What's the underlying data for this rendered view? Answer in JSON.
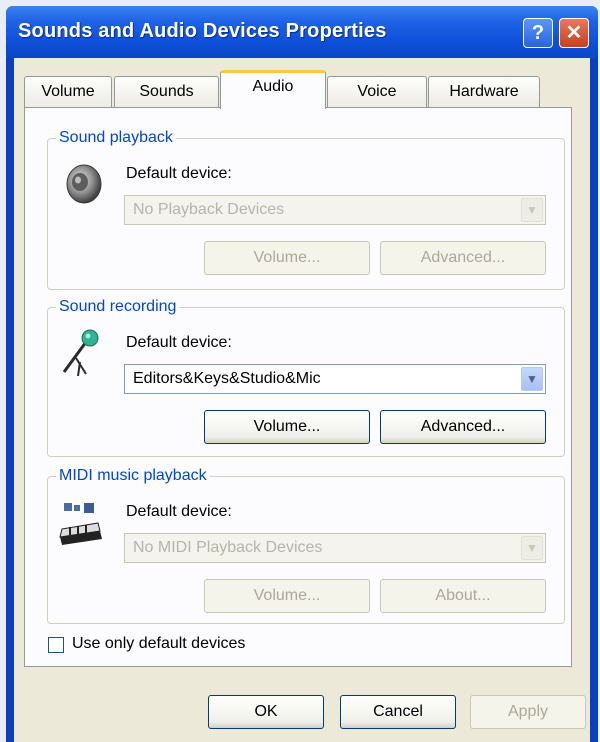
{
  "window": {
    "title": "Sounds and Audio Devices Properties",
    "help_label": "?",
    "close_label": "✕"
  },
  "tabs": [
    {
      "label": "Volume",
      "active": false
    },
    {
      "label": "Sounds",
      "active": false
    },
    {
      "label": "Audio",
      "active": true
    },
    {
      "label": "Voice",
      "active": false
    },
    {
      "label": "Hardware",
      "active": false
    }
  ],
  "playback": {
    "legend": "Sound playback",
    "device_label": "Default device:",
    "device_value": "No Playback Devices",
    "volume_label": "Volume...",
    "advanced_label": "Advanced..."
  },
  "recording": {
    "legend": "Sound recording",
    "device_label": "Default device:",
    "device_value": "Editors&Keys&Studio&Mic",
    "volume_label": "Volume...",
    "advanced_label": "Advanced..."
  },
  "midi": {
    "legend": "MIDI music playback",
    "device_label": "Default device:",
    "device_value": "No MIDI Playback Devices",
    "volume_label": "Volume...",
    "about_label": "About..."
  },
  "use_default_only": {
    "label": "Use only default devices",
    "checked": false
  },
  "dialog_buttons": {
    "ok": "OK",
    "cancel": "Cancel",
    "apply": "Apply"
  },
  "colors": {
    "titlebar": "#0d4fd9",
    "group_legend": "#0046d5",
    "active_tab_accent": "#ffc83c",
    "dialog_face": "#ece9d8"
  },
  "icons": {
    "playback": "speaker-icon",
    "recording": "microphone-icon",
    "midi": "midi-keyboard-icon"
  }
}
